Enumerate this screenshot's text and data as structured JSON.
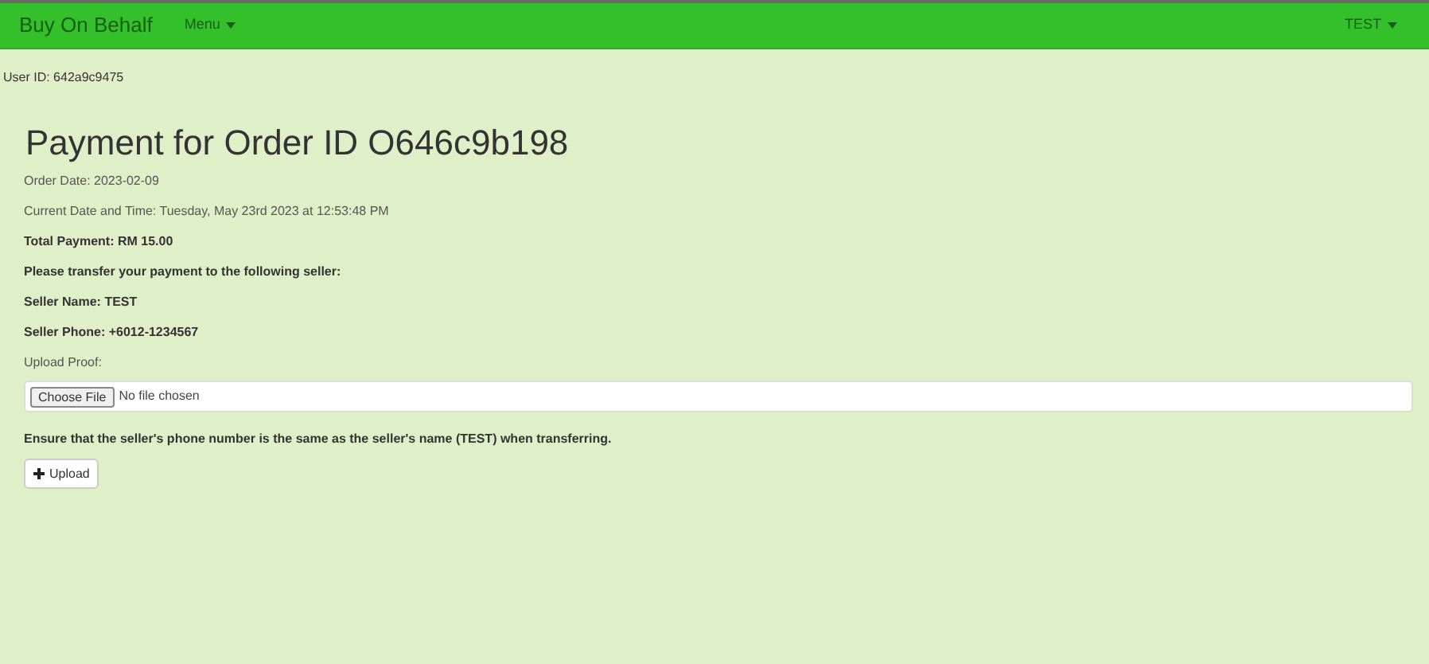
{
  "navbar": {
    "brand": "Buy On Behalf",
    "menu": "Menu",
    "user_menu": "TEST"
  },
  "user_id": "User ID: 642a9c9475",
  "title": "Payment for Order ID O646c9b198",
  "details": [
    {
      "text": "Order Date: 2023-02-09",
      "bold": false
    },
    {
      "text": "Current Date and Time: Tuesday, May 23rd 2023 at 12:53:48 PM",
      "bold": false
    },
    {
      "text": "Total Payment: RM 15.00",
      "bold": true
    },
    {
      "text": "Please transfer your payment to the following seller:",
      "bold": true
    },
    {
      "text": "Seller Name: TEST",
      "bold": true
    },
    {
      "text": "Seller Phone: +6012-1234567",
      "bold": true
    }
  ],
  "upload_label": "Upload Proof:",
  "file_input": {
    "button": "Choose File",
    "status": "No file chosen"
  },
  "notice": "Ensure that the seller's phone number is the same as the seller's name (TEST) when transferring.",
  "upload_button": "Upload"
}
